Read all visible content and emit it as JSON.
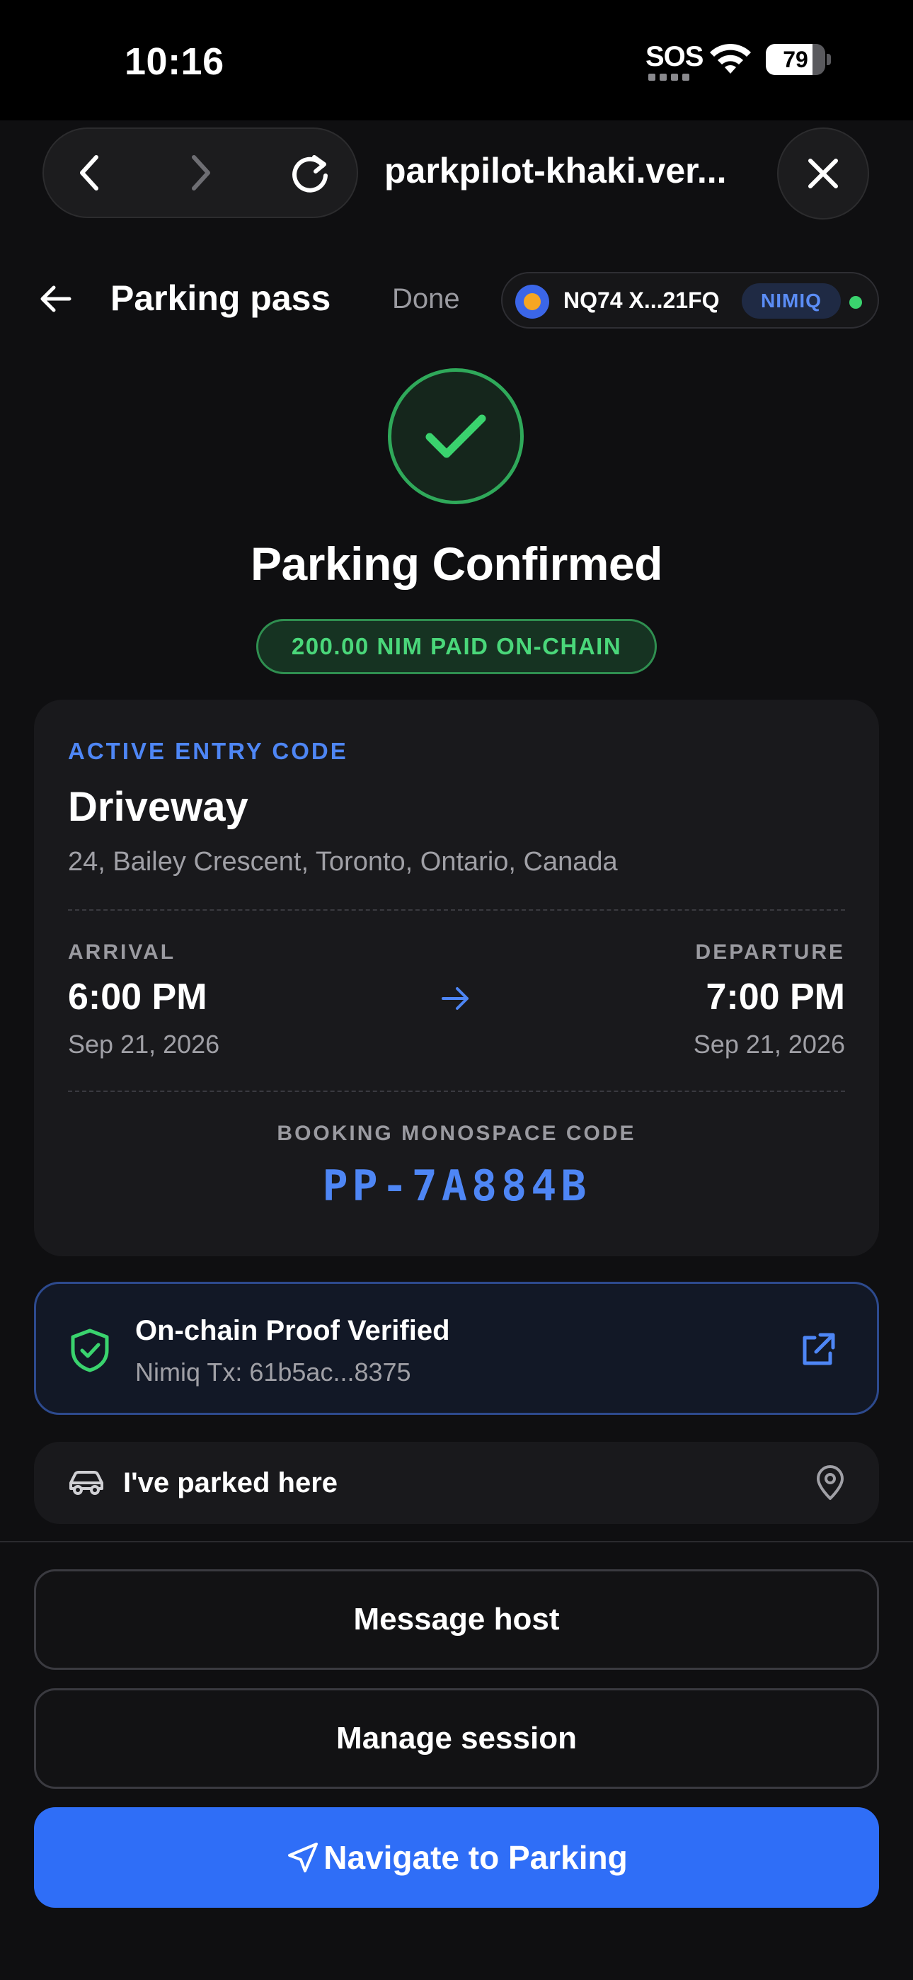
{
  "status_bar": {
    "time": "10:16",
    "sos": "SOS",
    "battery": "79",
    "battery_level": 0.79
  },
  "browser": {
    "url": "parkpilot-khaki.ver..."
  },
  "header": {
    "title": "Parking pass",
    "done_label": "Done"
  },
  "wallet": {
    "address": "NQ74 X...21FQ",
    "network": "NIMIQ",
    "status_color": "#3ad36e"
  },
  "confirmation": {
    "title": "Parking Confirmed",
    "paid_badge": "200.00 NIM PAID ON-CHAIN"
  },
  "ticket": {
    "section_label": "ACTIVE ENTRY CODE",
    "place_name": "Driveway",
    "address": "24, Bailey Crescent, Toronto, Ontario, Canada",
    "arrival_label": "ARRIVAL",
    "arrival_time": "6:00 PM",
    "arrival_date": "Sep 21, 2026",
    "departure_label": "DEPARTURE",
    "departure_time": "7:00 PM",
    "departure_date": "Sep 21, 2026",
    "code_label": "BOOKING MONOSPACE CODE",
    "code": "PP-7A884B"
  },
  "proof": {
    "title": "On-chain Proof Verified",
    "tx": "Nimiq Tx: 61b5ac...8375"
  },
  "parked": {
    "label": "I've parked here"
  },
  "actions": {
    "message_host": "Message host",
    "manage_session": "Manage session",
    "navigate": "Navigate to Parking"
  },
  "colors": {
    "accent": "#2f6ef7",
    "success": "#4ad77a",
    "link": "#4e86f5"
  },
  "icons": [
    "back-chevron-icon",
    "forward-chevron-icon",
    "reload-icon",
    "close-icon",
    "arrow-left-icon",
    "check-icon",
    "arrow-right-icon",
    "shield-check-icon",
    "external-link-icon",
    "car-icon",
    "map-pin-icon",
    "navigation-icon"
  ]
}
